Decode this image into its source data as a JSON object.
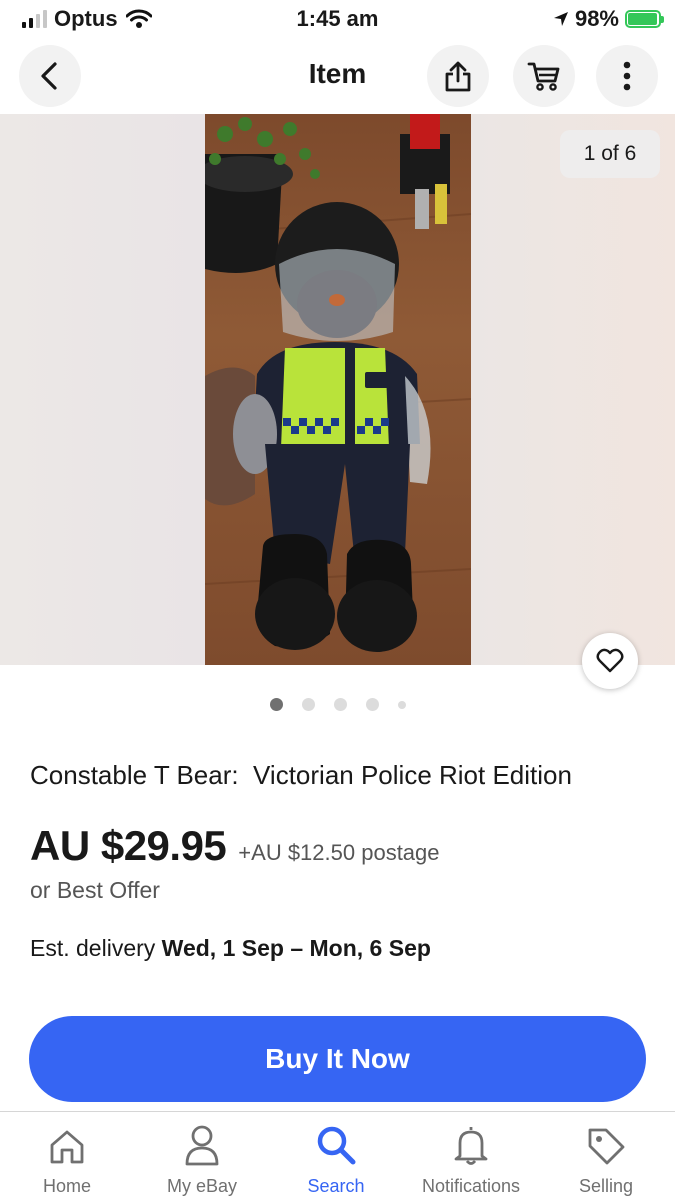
{
  "status": {
    "carrier": "Optus",
    "time": "1:45 am",
    "battery": "98%",
    "battery_level": 0.98
  },
  "nav": {
    "title": "Item",
    "back_icon": "chevron-left-icon",
    "share_icon": "share-icon",
    "cart_icon": "cart-icon",
    "more_icon": "more-vertical-icon"
  },
  "gallery": {
    "counter": "1 of 6",
    "current_index": 1,
    "total": 6,
    "watch_icon": "heart-icon"
  },
  "product": {
    "title": "Constable T Bear:  Victorian Police Riot Edition",
    "price": "AU $29.95",
    "postage": "+AU $12.50 postage",
    "offer": "or Best Offer",
    "delivery_label": "Est. delivery ",
    "delivery_dates": "Wed, 1 Sep – Mon, 6 Sep"
  },
  "actions": {
    "buy_label": "Buy It Now",
    "accent_color": "#3665f3"
  },
  "tabs": [
    {
      "label": "Home",
      "icon": "home-icon"
    },
    {
      "label": "My eBay",
      "icon": "person-icon"
    },
    {
      "label": "Search",
      "icon": "search-icon",
      "active": true
    },
    {
      "label": "Notifications",
      "icon": "bell-icon"
    },
    {
      "label": "Selling",
      "icon": "tag-icon"
    }
  ]
}
